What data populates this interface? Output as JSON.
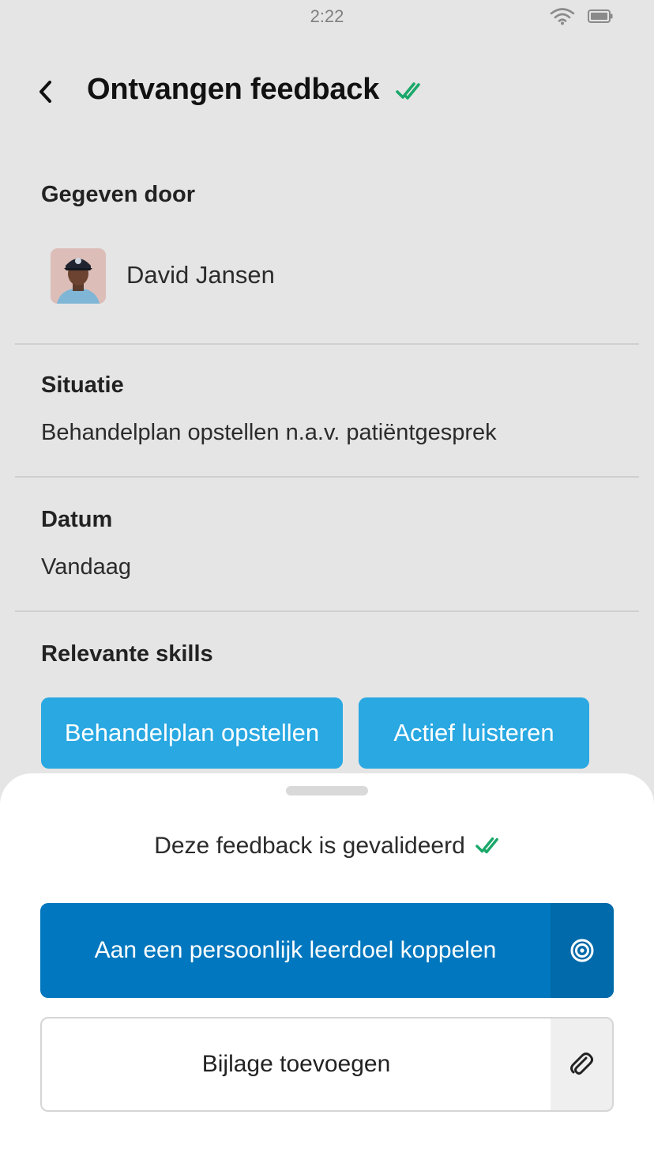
{
  "status_bar": {
    "time": "2:22"
  },
  "header": {
    "title": "Ontvangen feedback"
  },
  "given_by": {
    "label": "Gegeven door",
    "name": "David Jansen"
  },
  "situation": {
    "label": "Situatie",
    "value": "Behandelplan opstellen n.a.v. patiëntgesprek"
  },
  "date": {
    "label": "Datum",
    "value": "Vandaag"
  },
  "skills": {
    "label": "Relevante skills",
    "items": [
      "Behandelplan opstellen",
      "Actief luisteren"
    ]
  },
  "sheet": {
    "validated_text": "Deze feedback is gevalideerd",
    "primary_button": "Aan een persoonlijk leerdoel koppelen",
    "secondary_button": "Bijlage toevoegen"
  },
  "colors": {
    "background": "#e5e5e5",
    "chip": "#29a8e2",
    "primary": "#0077be",
    "check": "#1aa86a"
  },
  "icons": [
    "back-chevron-icon",
    "double-check-icon",
    "wifi-icon",
    "battery-icon",
    "target-icon",
    "paperclip-icon"
  ]
}
